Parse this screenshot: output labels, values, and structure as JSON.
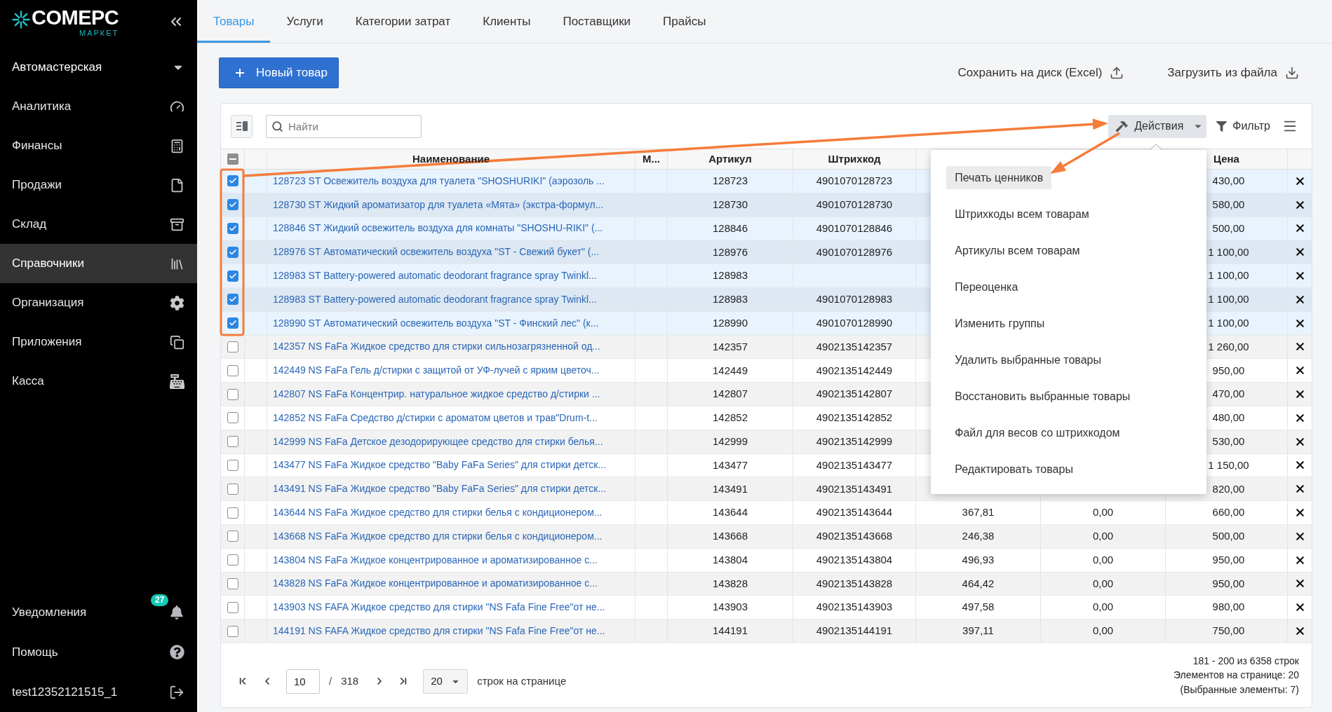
{
  "sidebar": {
    "logo": {
      "name": "COMEPC",
      "tagline": "МАРКЕТ"
    },
    "organization": "Автомастерская",
    "items": [
      {
        "label": "Аналитика",
        "selected": false
      },
      {
        "label": "Финансы",
        "selected": false
      },
      {
        "label": "Продажи",
        "selected": false
      },
      {
        "label": "Склад",
        "selected": false
      },
      {
        "label": "Справочники",
        "selected": true
      },
      {
        "label": "Организация",
        "selected": false
      },
      {
        "label": "Приложения",
        "selected": false
      },
      {
        "label": "Касса",
        "selected": false
      }
    ],
    "footer_items": [
      {
        "kind": "notifications",
        "label": "Уведомления",
        "badge": "27"
      },
      {
        "kind": "help",
        "label": "Помощь"
      },
      {
        "kind": "account",
        "label": "test12352121515_1"
      }
    ]
  },
  "tabs": [
    {
      "label": "Товары",
      "selected": true
    },
    {
      "label": "Услуги",
      "selected": false
    },
    {
      "label": "Категории затрат",
      "selected": false
    },
    {
      "label": "Клиенты",
      "selected": false
    },
    {
      "label": "Поставщики",
      "selected": false
    },
    {
      "label": "Прайсы",
      "selected": false
    }
  ],
  "toolbar": {
    "new_button": "Новый товар",
    "save_button": "Сохранить на диск (Excel)",
    "load_button": "Загрузить из файла"
  },
  "table": {
    "search": {
      "placeholder": "Найти"
    },
    "actions_button": "Действия",
    "filter_button": "Фильтр",
    "select_all": {
      "indeterminate": true
    },
    "headers": {
      "name": "Наименование",
      "m": "М...",
      "article": "Артикул",
      "barcode": "Штрихкод",
      "price": "Цена"
    },
    "rows": [
      {
        "selected": true,
        "name": "128723 ST Освежитель воздуха для туалета \"SHOSHURIKI\" (аэрозоль ...",
        "article": "128723",
        "barcode": "4901070128723",
        "price": "430,00"
      },
      {
        "selected": true,
        "name": "128730 ST Жидкий ароматизатор для туалета «Мята» (экстра-формул...",
        "article": "128730",
        "barcode": "4901070128730",
        "price": "580,00"
      },
      {
        "selected": true,
        "name": "128846 ST Жидкий освежитель воздуха для комнаты \"SHOSHU-RIKI\" (...",
        "article": "128846",
        "barcode": "4901070128846",
        "price": "500,00"
      },
      {
        "selected": true,
        "name": "128976 ST Автоматический освежитель воздуха \"ST - Свежий букет\" (...",
        "article": "128976",
        "barcode": "4901070128976",
        "price": "1 100,00"
      },
      {
        "selected": true,
        "name": "128983 ST Battery-powered automatic deodorant fragrance spray Twinkl...",
        "article": "128983",
        "price": "1 100,00"
      },
      {
        "selected": true,
        "name": "128983 ST Battery-powered automatic deodorant fragrance spray Twinkl...",
        "article": "128983",
        "barcode": "4901070128983",
        "price": "1 100,00"
      },
      {
        "selected": true,
        "name": "128990 ST Автоматический освежитель воздуха \"ST - Финский лес\" (к...",
        "article": "128990",
        "barcode": "4901070128990",
        "price": "1 100,00"
      },
      {
        "selected": false,
        "name": "142357 NS FaFa Жидкое средство для стирки сильнозагрязненной од...",
        "article": "142357",
        "barcode": "4902135142357",
        "price": "1 260,00"
      },
      {
        "selected": false,
        "name": "142449 NS FaFa Гель д/стирки с защитой от УФ-лучей с ярким цветоч...",
        "article": "142449",
        "barcode": "4902135142449",
        "price": "950,00"
      },
      {
        "selected": false,
        "name": "142807 NS FaFa Концентрир. натуральное жидкое средство д/стирки ...",
        "article": "142807",
        "barcode": "4902135142807",
        "price": "470,00"
      },
      {
        "selected": false,
        "name": "142852 NS FaFa Средство д/стирки с ароматом цветов и трав\"Drum-t...",
        "article": "142852",
        "barcode": "4902135142852",
        "price": "480,00"
      },
      {
        "selected": false,
        "name": "142999 NS FaFa Детское дезодорирующее средство для стирки белья...",
        "article": "142999",
        "barcode": "4902135142999",
        "price": "530,00"
      },
      {
        "selected": false,
        "name": "143477 NS FaFa Жидкое средство \"Baby FaFa Series\" для стирки детск...",
        "article": "143477",
        "barcode": "4902135143477",
        "price": "1 150,00"
      },
      {
        "selected": false,
        "name": "143491 NS FaFa Жидкое средство \"Baby FaFa Series\" для стирки детск...",
        "article": "143491",
        "barcode": "4902135143491",
        "price": "820,00"
      },
      {
        "selected": false,
        "name": "143644 NS FaFa Жидкое средство для стирки белья с кондиционером...",
        "article": "143644",
        "barcode": "4902135143644",
        "column_5": "367,81",
        "column_6": "0,00",
        "price": "660,00"
      },
      {
        "selected": false,
        "name": "143668 NS FaFa Жидкое средство для стирки белья с кондиционером...",
        "article": "143668",
        "barcode": "4902135143668",
        "column_5": "246,38",
        "column_6": "0,00",
        "price": "500,00"
      },
      {
        "selected": false,
        "name": "143804 NS FaFa Жидкое концентрированное и ароматизированное с...",
        "article": "143804",
        "barcode": "4902135143804",
        "column_5": "496,93",
        "column_6": "0,00",
        "price": "950,00"
      },
      {
        "selected": false,
        "name": "143828 NS FaFa Жидкое концентрированное и ароматизированное с...",
        "article": "143828",
        "barcode": "4902135143828",
        "column_5": "464,42",
        "column_6": "0,00",
        "price": "950,00"
      },
      {
        "selected": false,
        "name": "143903 NS FAFA Жидкое средство для стирки \"NS Fafa Fine Free\"от не...",
        "article": "143903",
        "barcode": "4902135143903",
        "column_5": "497,58",
        "column_6": "0,00",
        "price": "980,00"
      },
      {
        "selected": false,
        "name": "144191 NS FAFA Жидкое средство для стирки \"NS Fafa Fine Free\"от не...",
        "article": "144191",
        "barcode": "4902135144191",
        "column_5": "397,11",
        "column_6": "0,00",
        "price": "750,00"
      }
    ]
  },
  "actions_menu": {
    "items": [
      {
        "label": "Печать ценников",
        "selected": true
      },
      {
        "label": "Штрихкоды всем товарам",
        "selected": false
      },
      {
        "label": "Артикулы всем товарам",
        "selected": false
      },
      {
        "label": "Переоценка",
        "selected": false
      },
      {
        "label": "Изменить группы",
        "selected": false
      },
      {
        "label": "Удалить выбранные товары",
        "selected": false
      },
      {
        "label": "Восстановить выбранные товары",
        "selected": false
      },
      {
        "label": "Файл для весов со штрихкодом",
        "selected": false
      },
      {
        "label": "Редактировать товары",
        "selected": false
      }
    ]
  },
  "pagination": {
    "page": "10",
    "separator": "/",
    "total_pages": "318",
    "page_size": "20",
    "page_size_label": "строк на странице",
    "range": "181 - 200 из 6358 строк",
    "per_page_info": "Элементов на странице: 20",
    "selected_info": "(Выбранные элементы: 7)"
  }
}
